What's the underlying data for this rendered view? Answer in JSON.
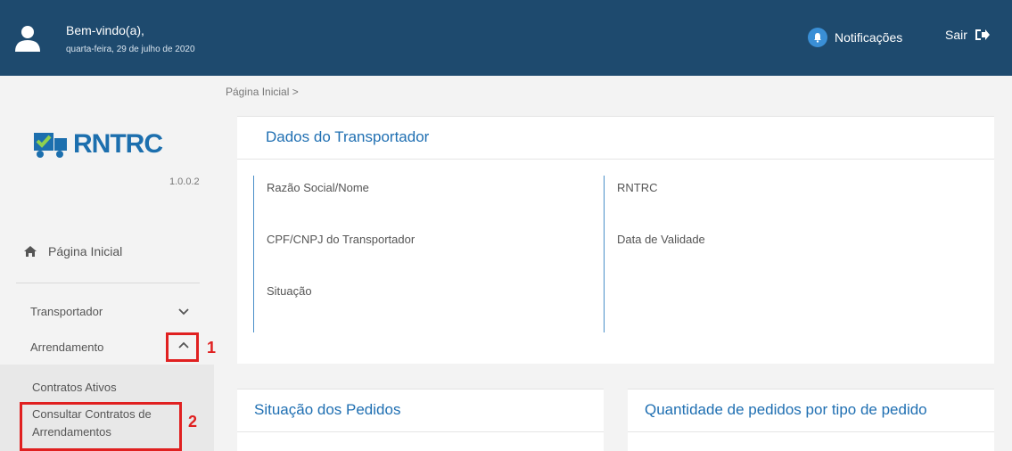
{
  "header": {
    "welcome": "Bem-vindo(a),",
    "date": "quarta-feira, 29 de julho de 2020",
    "notifications_label": "Notificações",
    "logout_label": "Sair"
  },
  "sidebar": {
    "logo_text": "RNTRC",
    "version": "1.0.0.2",
    "home_label": "Página Inicial",
    "menu": [
      {
        "label": "Transportador",
        "expanded": false
      },
      {
        "label": "Arrendamento",
        "expanded": true
      }
    ],
    "submenu": [
      {
        "label": "Contratos Ativos"
      },
      {
        "label": "Consultar Contratos de Arrendamentos"
      }
    ],
    "annotations": [
      "1",
      "2"
    ]
  },
  "breadcrumb": "Página Inicial  >",
  "transporter_card": {
    "title": "Dados do Transportador",
    "left_fields": [
      "Razão Social/Nome",
      "CPF/CNPJ do Transportador",
      "Situação"
    ],
    "right_fields": [
      "RNTRC",
      "Data de Validade"
    ]
  },
  "orders_status_card": {
    "title": "Situação dos Pedidos"
  },
  "orders_type_card": {
    "title": "Quantidade de pedidos por tipo de pedido"
  },
  "colors": {
    "header_bg": "#1e4a6e",
    "accent": "#1f6fb2",
    "highlight": "#e02020"
  }
}
